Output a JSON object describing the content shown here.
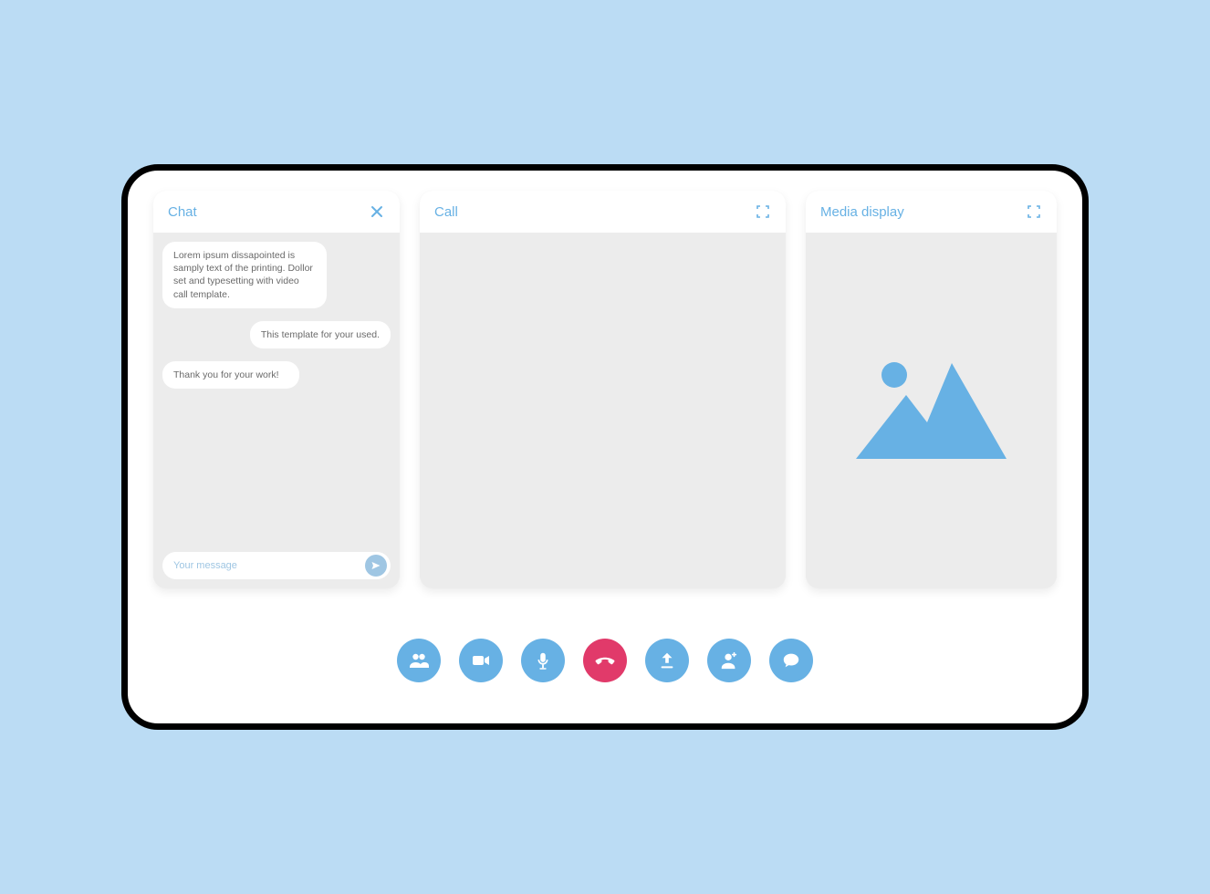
{
  "colors": {
    "accent": "#67b1e4",
    "end_call": "#e13a6a",
    "panel_bg": "#ececec",
    "page_bg": "#bbdcf4"
  },
  "chat": {
    "title": "Chat",
    "messages": [
      "Lorem ipsum dissapointed is samply text of the printing. Dollor set and typesetting with video call template.",
      "This template for your used.",
      "Thank you for your work!"
    ],
    "compose_placeholder": "Your message"
  },
  "call": {
    "title": "Call"
  },
  "media": {
    "title": "Media display"
  },
  "controls": {
    "participants": "participants",
    "video": "video",
    "mic": "microphone",
    "end": "end-call",
    "share": "share-upload",
    "add_user": "add-user",
    "chat": "chat"
  }
}
